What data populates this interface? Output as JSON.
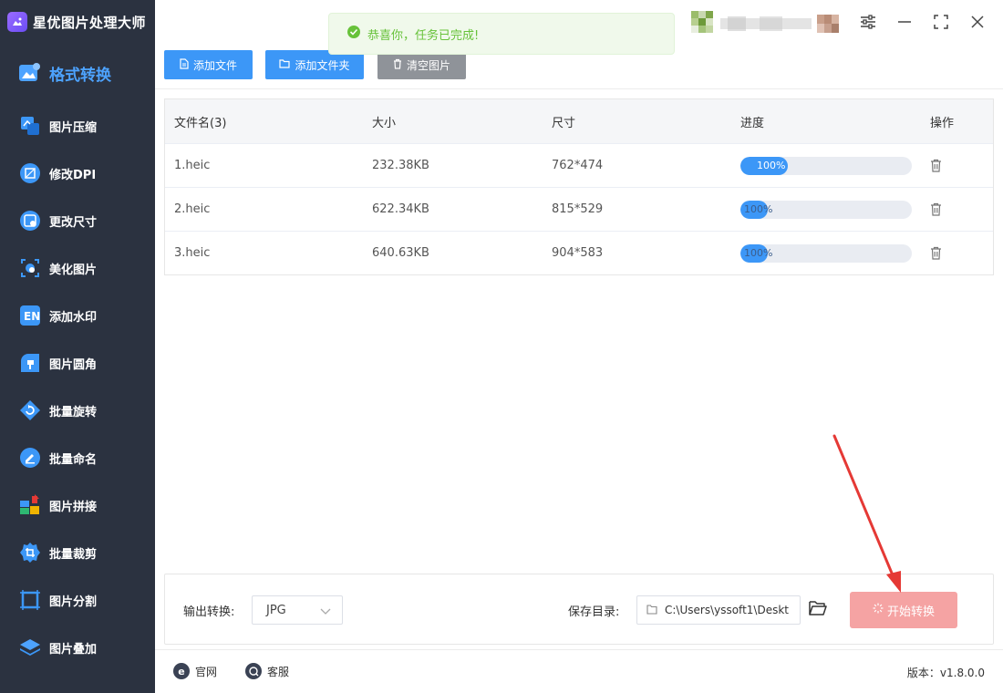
{
  "app": {
    "title": "星优图片处理大师"
  },
  "sidebar": {
    "items": [
      {
        "label": "格式转换",
        "icon": "image-convert-icon",
        "active": true
      },
      {
        "label": "图片压缩",
        "icon": "compress-icon"
      },
      {
        "label": "修改DPI",
        "icon": "dpi-icon"
      },
      {
        "label": "更改尺寸",
        "icon": "resize-icon"
      },
      {
        "label": "美化图片",
        "icon": "beautify-icon"
      },
      {
        "label": "添加水印",
        "icon": "watermark-icon"
      },
      {
        "label": "图片圆角",
        "icon": "rounded-corner-icon"
      },
      {
        "label": "批量旋转",
        "icon": "rotate-icon"
      },
      {
        "label": "批量命名",
        "icon": "rename-icon"
      },
      {
        "label": "图片拼接",
        "icon": "puzzle-icon"
      },
      {
        "label": "批量裁剪",
        "icon": "crop-icon"
      },
      {
        "label": "图片分割",
        "icon": "split-icon"
      },
      {
        "label": "图片叠加",
        "icon": "layers-icon"
      }
    ]
  },
  "toast": {
    "message": "恭喜你，任务已完成!",
    "color": "#67c23a"
  },
  "toolbar": {
    "add_file": "添加文件",
    "add_folder": "添加文件夹",
    "clear": "清空图片"
  },
  "table": {
    "headers": {
      "name": "文件名(3)",
      "size": "大小",
      "dimensions": "尺寸",
      "progress": "进度",
      "actions": "操作"
    },
    "rows": [
      {
        "name": "1.heic",
        "size": "232.38KB",
        "dimensions": "762*474",
        "progress_text": "100%",
        "progress": 100
      },
      {
        "name": "2.heic",
        "size": "622.34KB",
        "dimensions": "815*529",
        "progress_text": "100%",
        "progress": 100
      },
      {
        "name": "3.heic",
        "size": "640.63KB",
        "dimensions": "904*583",
        "progress_text": "100%",
        "progress": 100
      }
    ]
  },
  "bottom": {
    "output_label": "输出转换:",
    "output_format": "JPG",
    "save_label": "保存目录:",
    "save_path": "C:\\Users\\yssoft1\\Deskt",
    "start_button": "开始转换"
  },
  "footer": {
    "website": "官网",
    "support": "客服",
    "version": "版本：v1.8.0.0"
  },
  "colors": {
    "accent": "#3c97f7",
    "sidebar": "#2b3240",
    "start_button": "#f5a3a3",
    "annotation_arrow": "#e53935"
  }
}
